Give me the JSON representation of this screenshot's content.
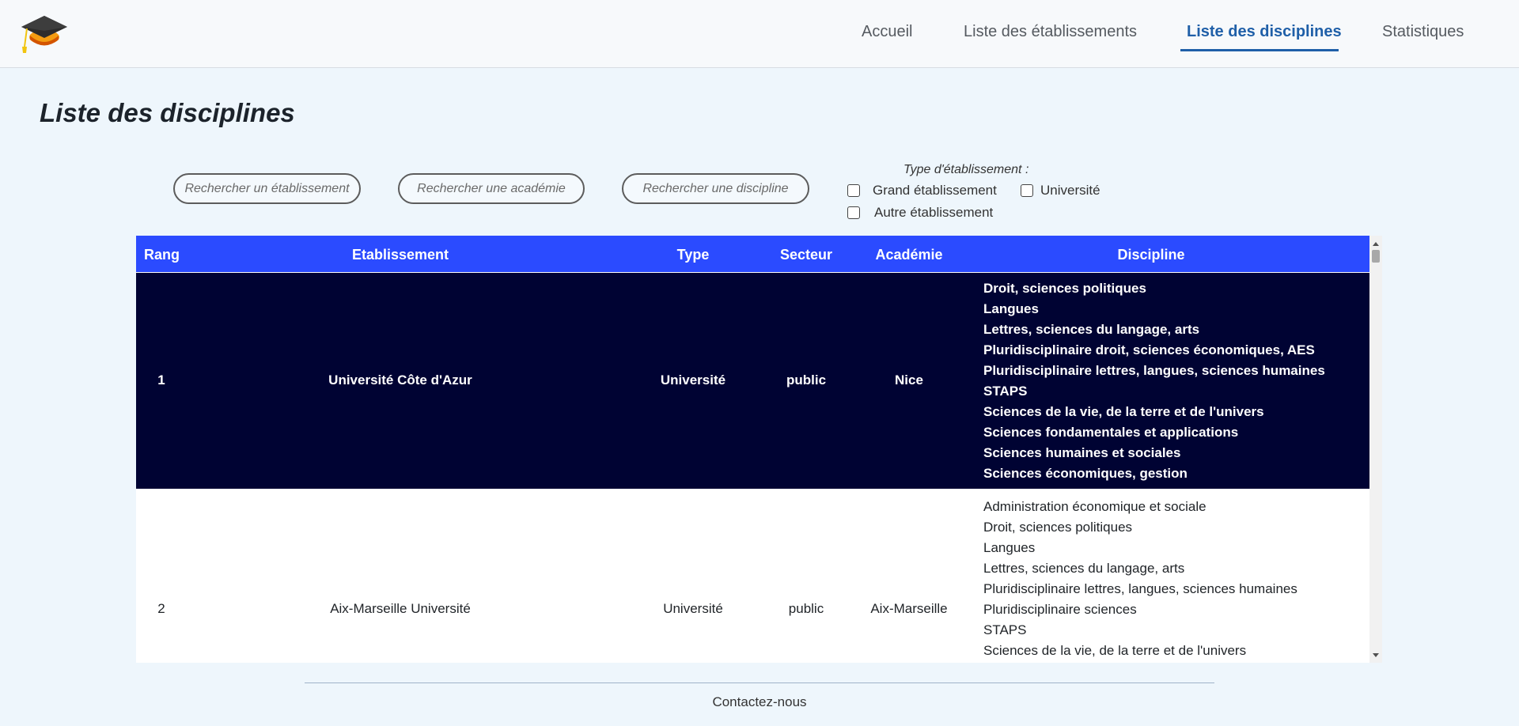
{
  "nav": {
    "items": [
      {
        "label": "Accueil",
        "active": false
      },
      {
        "label": "Liste des établissements",
        "active": false
      },
      {
        "label": "Liste des disciplines",
        "active": true
      },
      {
        "label": "Statistiques",
        "active": false
      }
    ],
    "accent_color": "#1f5fa8",
    "logo_icon": "graduation-cap-icon"
  },
  "page": {
    "title": "Liste des disciplines"
  },
  "filters": {
    "search_etablissement_placeholder": "Rechercher un établissement",
    "search_academie_placeholder": "Rechercher une académie",
    "search_discipline_placeholder": "Rechercher une discipline",
    "type_label": "Type d'établissement :",
    "checkboxes": [
      {
        "label": "Grand établissement",
        "checked": false
      },
      {
        "label": "Université",
        "checked": false
      },
      {
        "label": "Autre établissement",
        "checked": false
      }
    ]
  },
  "table": {
    "header_color": "#2b4bff",
    "highlight_color": "#000333",
    "columns": [
      "Rang",
      "Etablissement",
      "Type",
      "Secteur",
      "Académie",
      "Discipline"
    ],
    "rows": [
      {
        "rang": "1",
        "etablissement": "Université Côte d'Azur",
        "type": "Université",
        "secteur": "public",
        "academie": "Nice",
        "disciplines": [
          "Droit, sciences politiques",
          "Langues",
          "Lettres, sciences du langage, arts",
          "Pluridisciplinaire droit, sciences économiques, AES",
          "Pluridisciplinaire lettres, langues, sciences humaines",
          "STAPS",
          "Sciences de la vie, de la terre et de l'univers",
          "Sciences fondamentales et applications",
          "Sciences humaines et sociales",
          "Sciences économiques, gestion"
        ]
      },
      {
        "rang": "2",
        "etablissement": "Aix-Marseille Université",
        "type": "Université",
        "secteur": "public",
        "academie": "Aix-Marseille",
        "disciplines": [
          "Administration économique et sociale",
          "Droit, sciences politiques",
          "Langues",
          "Lettres, sciences du langage, arts",
          "Pluridisciplinaire lettres, langues, sciences humaines",
          "Pluridisciplinaire sciences",
          "STAPS",
          "Sciences de la vie, de la terre et de l'univers"
        ]
      }
    ]
  },
  "footer": {
    "contact_label": "Contactez-nous"
  }
}
